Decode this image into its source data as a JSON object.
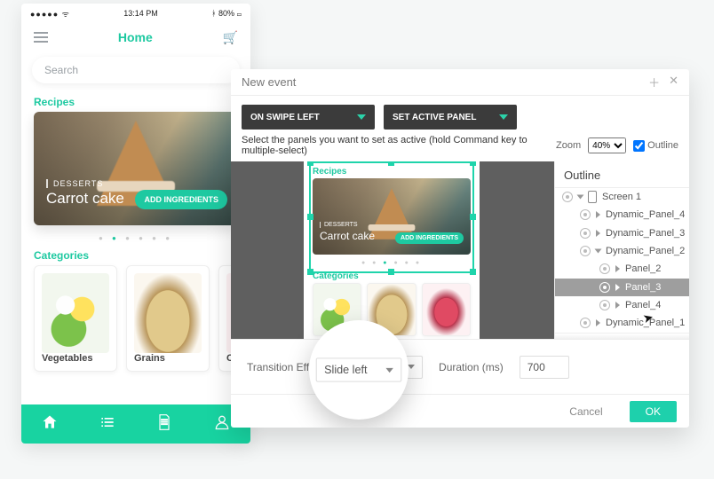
{
  "brand_color": "#1ec9a1",
  "phone": {
    "status": {
      "time": "13:14 PM",
      "battery": "80%",
      "bt": "✱"
    },
    "title": "Home",
    "search_placeholder": "Search",
    "section_recipes": "Recipes",
    "hero": {
      "tag": "DESSERTS",
      "title": "Carrot cake",
      "button": "ADD INGREDIENTS"
    },
    "section_categories": "Categories",
    "categories": [
      {
        "name": "Vegetables"
      },
      {
        "name": "Grains"
      },
      {
        "name": "Cos"
      }
    ],
    "tabs": [
      "home",
      "list",
      "doc",
      "user"
    ]
  },
  "modal": {
    "title": "New event",
    "trigger_label": "ON SWIPE LEFT",
    "action_label": "SET ACTIVE PANEL",
    "instruction": "Select the panels you want to set as active (hold Command key to multiple-select)",
    "zoom_label": "Zoom",
    "zoom_value": "40%",
    "outline_checkbox": "Outline",
    "outline_checked": true,
    "outline": {
      "title": "Outline",
      "items": [
        {
          "level": 1,
          "label": "Screen 1",
          "open": true,
          "device": true
        },
        {
          "level": 2,
          "label": "Dynamic_Panel_4"
        },
        {
          "level": 2,
          "label": "Dynamic_Panel_3"
        },
        {
          "level": 2,
          "label": "Dynamic_Panel_2",
          "open": true
        },
        {
          "level": 3,
          "label": "Panel_2"
        },
        {
          "level": 3,
          "label": "Panel_3",
          "selected": true
        },
        {
          "level": 3,
          "label": "Panel_4"
        },
        {
          "level": 2,
          "label": "Dynamic_Panel_1"
        }
      ]
    },
    "config": {
      "transition_label": "Transition Effect",
      "transition_value": "Slide left",
      "duration_label": "Duration (ms)",
      "duration_value": "700"
    },
    "actions": {
      "cancel": "Cancel",
      "ok": "OK"
    }
  },
  "preview": {
    "section_recipes": "Recipes",
    "hero": {
      "tag": "DESSERTS",
      "title": "Carrot cake",
      "button": "ADD INGREDIENTS"
    },
    "section_categories": "Categories"
  }
}
